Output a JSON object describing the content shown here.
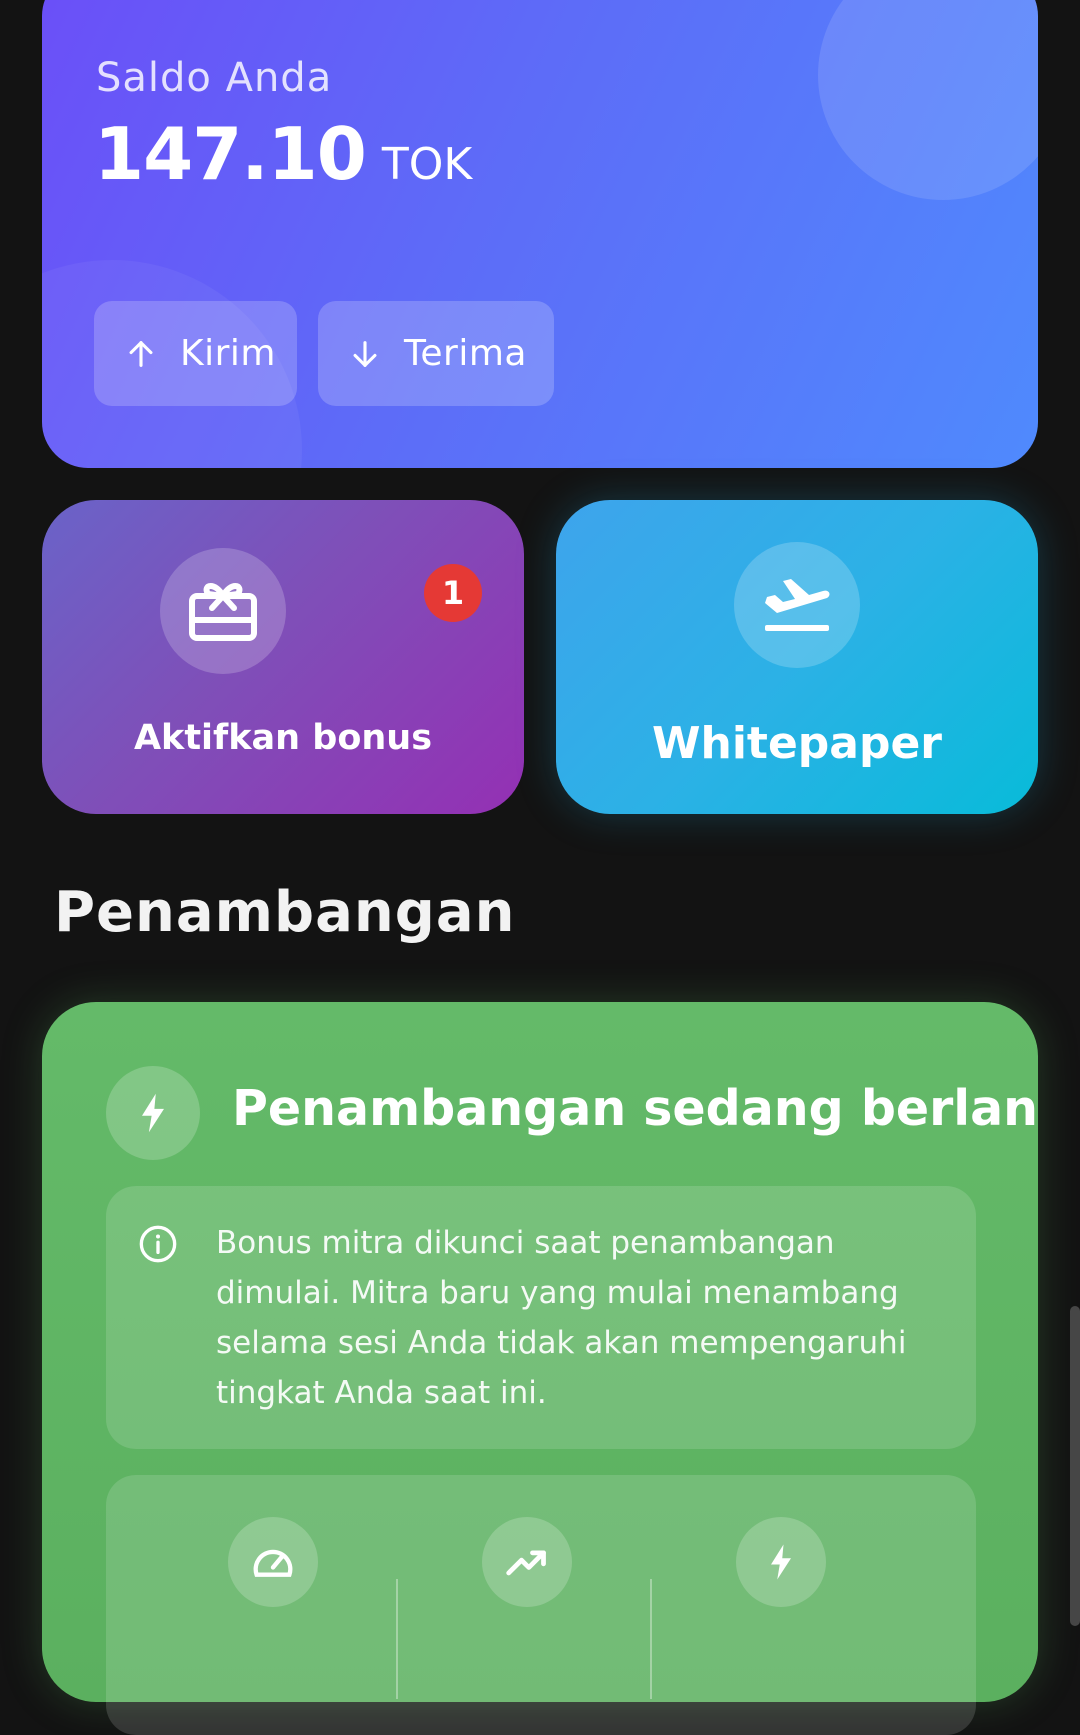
{
  "balance": {
    "label": "Saldo Anda",
    "amount": "147.10",
    "unit": "TOK"
  },
  "actions": {
    "send_label": "Kirim",
    "receive_label": "Terima"
  },
  "tiles": {
    "bonus_label": "Aktifkan bonus",
    "bonus_badge": "1",
    "whitepaper_label": "Whitepaper"
  },
  "mining": {
    "section_title": "Penambangan",
    "status": "Penambangan sedang berlangsung",
    "info": "Bonus mitra dikunci saat penambangan dimulai. Mitra baru yang mulai menambang selama sesi Anda tidak akan mempengaruhi tingkat Anda saat ini.",
    "stat_icons": [
      "speedometer-icon",
      "trending-up-icon",
      "lightning-icon"
    ]
  },
  "colors": {
    "balance_gradient_start": "#6b4ff8",
    "balance_gradient_end": "#4f8afd",
    "bonus_tile": "#9430b4",
    "whitepaper_tile": "#08bbd9",
    "mining_card": "#5bb05f",
    "badge": "#e53935",
    "background": "#131313"
  }
}
